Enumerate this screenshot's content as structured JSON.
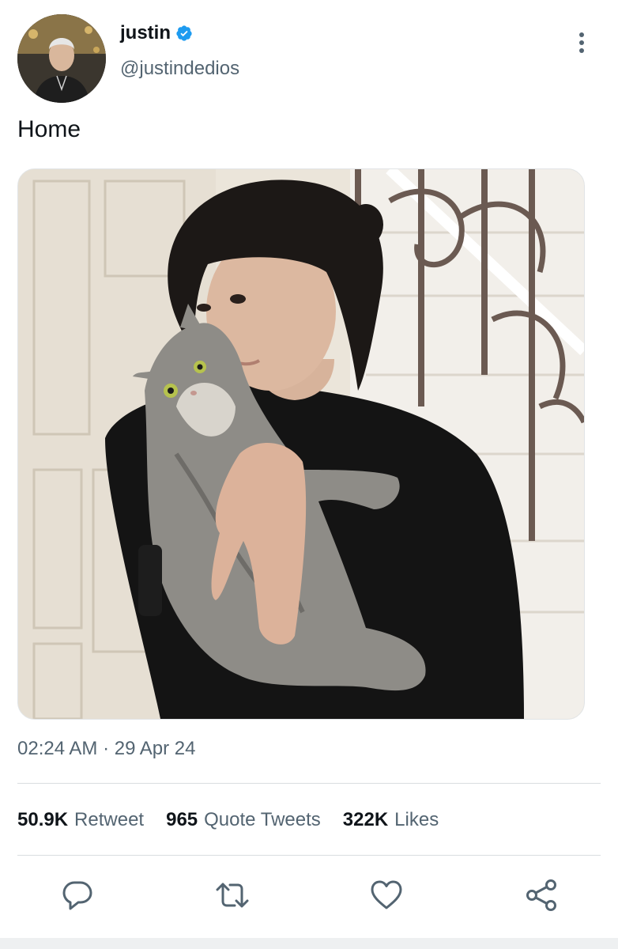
{
  "author": {
    "display_name": "justin",
    "handle": "@justindedios",
    "verified": true
  },
  "tweet": {
    "text": "Home",
    "timestamp": "02:24 AM · 29 Apr 24"
  },
  "stats": {
    "retweets_count": "50.9K",
    "retweets_label": "Retweet",
    "quotes_count": "965",
    "quotes_label": "Quote Tweets",
    "likes_count": "322K",
    "likes_label": "Likes"
  },
  "icons": {
    "more": "more-vertical-icon",
    "verified": "verified-badge-icon",
    "reply": "reply-icon",
    "retweet": "retweet-icon",
    "like": "heart-icon",
    "share": "share-icon"
  },
  "colors": {
    "text_primary": "#0f1419",
    "text_secondary": "#536471",
    "verified_blue": "#1d9bf0",
    "icon_gray": "#536471"
  }
}
